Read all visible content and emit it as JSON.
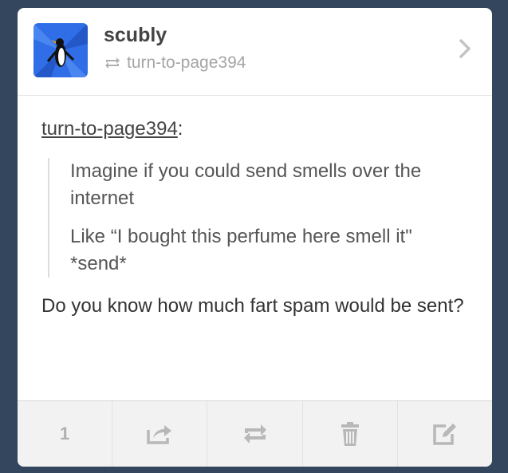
{
  "post": {
    "username": "scubly",
    "reblogged_from": "turn-to-page394",
    "source_user": "turn-to-page394",
    "source_suffix": ":",
    "quote_lines": [
      "Imagine if you could send smells over the internet",
      "Like “I bought this perfume here smell it\" *send*"
    ],
    "reply": "Do you know how much fart spam would be sent?"
  },
  "footer": {
    "notes_count": "1",
    "icons": [
      "share-icon",
      "reblog-icon",
      "trash-icon",
      "edit-icon"
    ]
  },
  "colors": {
    "background": "#34465d",
    "avatar_blue": "#2f6ee6",
    "text": "#444444",
    "muted": "#a5a5a5"
  }
}
